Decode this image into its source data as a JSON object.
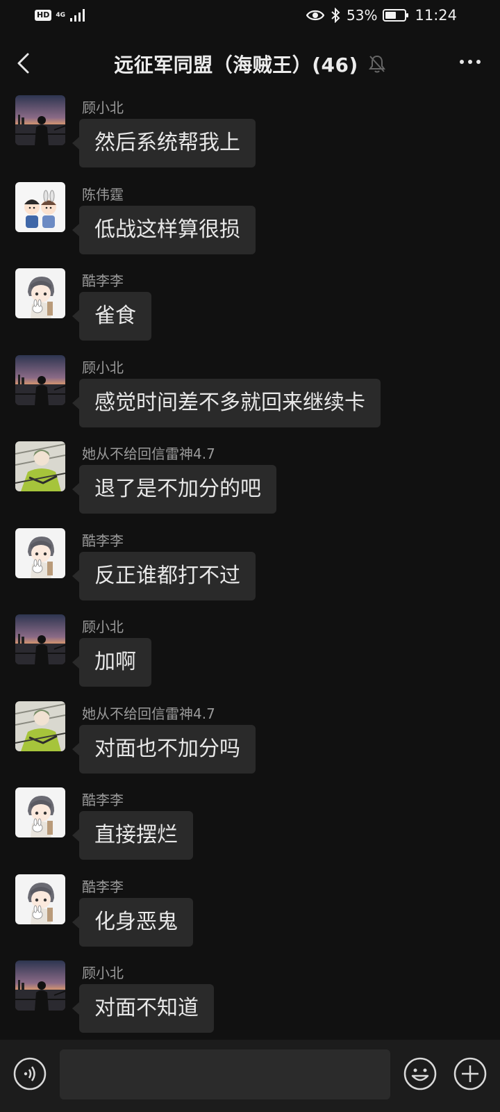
{
  "status_bar": {
    "hd": "HD",
    "network": "4G",
    "battery_percent": "53%",
    "time": "11:24"
  },
  "header": {
    "title": "远征军同盟（海贼王）(46)"
  },
  "messages": [
    {
      "sender": "顾小北",
      "text": "然后系统帮我上",
      "avatar": "sunset-silhouette"
    },
    {
      "sender": "陈伟霆",
      "text": "低战这样算很损",
      "avatar": "cartoon-couple"
    },
    {
      "sender": "酷李李",
      "text": "雀食",
      "avatar": "cartoon-boy-bunny"
    },
    {
      "sender": "顾小北",
      "text": "感觉时间差不多就回来继续卡",
      "avatar": "sunset-silhouette"
    },
    {
      "sender": "她从不给回信雷神4.7",
      "text": "退了是不加分的吧",
      "avatar": "anime-green"
    },
    {
      "sender": "酷李李",
      "text": "反正谁都打不过",
      "avatar": "cartoon-boy-bunny"
    },
    {
      "sender": "顾小北",
      "text": "加啊",
      "avatar": "sunset-silhouette"
    },
    {
      "sender": "她从不给回信雷神4.7",
      "text": "对面也不加分吗",
      "avatar": "anime-green"
    },
    {
      "sender": "酷李李",
      "text": "直接摆烂",
      "avatar": "cartoon-boy-bunny"
    },
    {
      "sender": "酷李李",
      "text": "化身恶鬼",
      "avatar": "cartoon-boy-bunny"
    },
    {
      "sender": "顾小北",
      "text": "对面不知道",
      "avatar": "sunset-silhouette"
    }
  ],
  "input_bar": {
    "icons": [
      "voice-icon",
      "emoji-icon",
      "plus-icon"
    ]
  }
}
